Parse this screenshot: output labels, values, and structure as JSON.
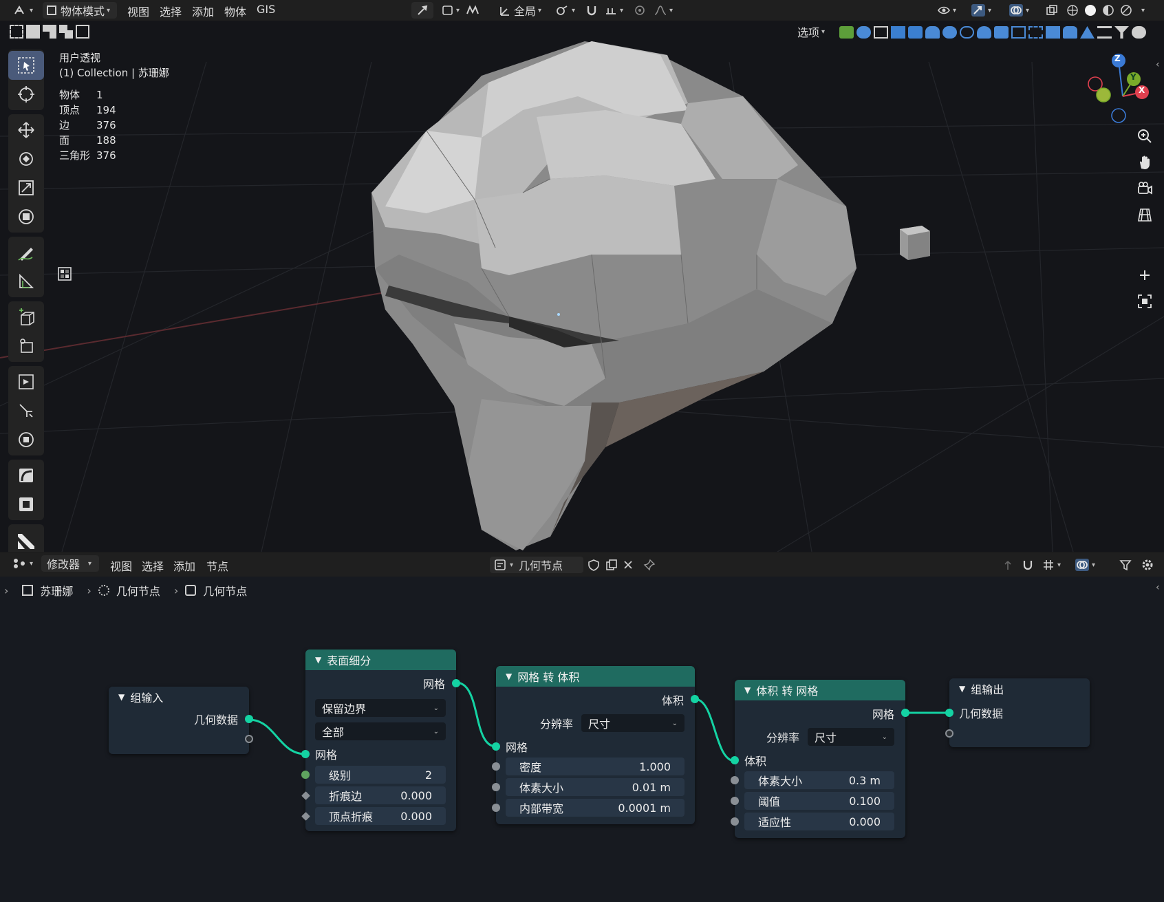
{
  "top_header": {
    "mode": "物体模式",
    "menus": [
      "视图",
      "选择",
      "添加",
      "物体",
      "GIS"
    ],
    "transform_orientation": "全局",
    "options": "选项"
  },
  "viewport": {
    "view_name": "用户透视",
    "collection_line": "(1) Collection | 苏珊娜",
    "stats": [
      {
        "label": "物体",
        "value": "1"
      },
      {
        "label": "顶点",
        "value": "194"
      },
      {
        "label": "边",
        "value": "376"
      },
      {
        "label": "面",
        "value": "188"
      },
      {
        "label": "三角形",
        "value": "376"
      }
    ],
    "gizmo": {
      "z": "Z",
      "y": "Y",
      "x": "X"
    }
  },
  "node_header": {
    "editor_type": "修改器",
    "menus": [
      "视图",
      "选择",
      "添加",
      "节点"
    ],
    "tree_name": "几何节点"
  },
  "breadcrumb": {
    "object": "苏珊娜",
    "modifier": "几何节点",
    "tree": "几何节点"
  },
  "nodes": {
    "group_input": {
      "title": "组输入",
      "output": "几何数据"
    },
    "subdivide": {
      "title": "表面细分",
      "output": "网格",
      "uv_smooth": "保留边界",
      "boundary_smooth": "全部",
      "input_mesh": "网格",
      "level_label": "级别",
      "level_value": "2",
      "edge_crease_label": "折痕边",
      "edge_crease_value": "0.000",
      "vertex_crease_label": "顶点折痕",
      "vertex_crease_value": "0.000"
    },
    "mesh_to_volume": {
      "title": "网格 转 体积",
      "output": "体积",
      "resolution_label": "分辨率",
      "resolution_value": "尺寸",
      "input_mesh": "网格",
      "density_label": "密度",
      "density_value": "1.000",
      "voxel_size_label": "体素大小",
      "voxel_size_value": "0.01 m",
      "interior_band_label": "内部带宽",
      "interior_band_value": "0.0001 m"
    },
    "volume_to_mesh": {
      "title": "体积 转 网格",
      "output": "网格",
      "resolution_label": "分辨率",
      "resolution_value": "尺寸",
      "input_volume": "体积",
      "voxel_size_label": "体素大小",
      "voxel_size_value": "0.3 m",
      "threshold_label": "阈值",
      "threshold_value": "0.100",
      "adaptivity_label": "适应性",
      "adaptivity_value": "0.000"
    },
    "group_output": {
      "title": "组输出",
      "input": "几何数据"
    }
  },
  "colors": {
    "node_header_teal": "#1f6b60",
    "geometry_socket": "#14d3a3",
    "active_tool": "#4a5a7a",
    "axis_x": "#e0404f",
    "axis_y": "#7aaa2a",
    "axis_z": "#3a7ad6"
  }
}
